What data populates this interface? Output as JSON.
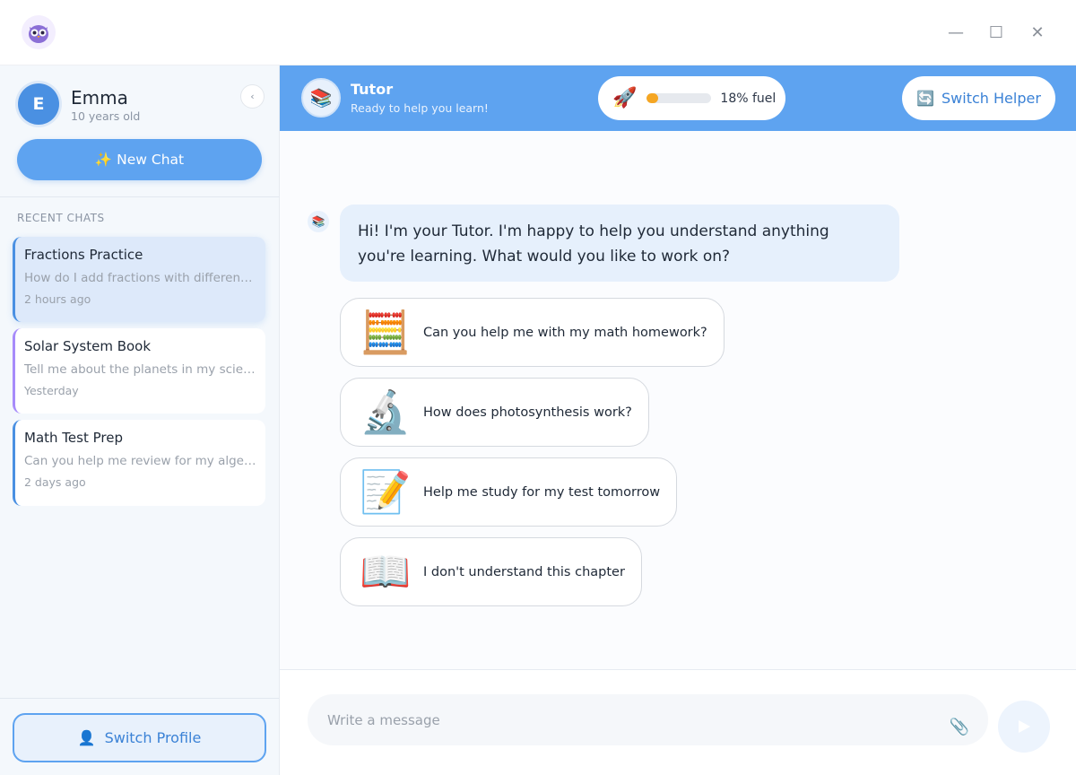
{
  "window": {
    "minimize_icon": "minimize-icon",
    "maximize_icon": "maximize-icon",
    "close_icon": "close-icon",
    "logo_icon": "owl-logo-icon",
    "minimize_glyph": "—",
    "maximize_glyph": "☐",
    "close_glyph": "✕"
  },
  "sidebar": {
    "user": {
      "initial": "E",
      "name": "Emma",
      "age": "10 years old"
    },
    "collapse_glyph": "‹",
    "new_chat_label": "✨ New Chat",
    "recent_title": "RECENT CHATS",
    "chats": [
      {
        "title": "Fractions Practice",
        "preview": "How do I add fractions with different denominators?",
        "time": "2 hours ago",
        "active": true,
        "accent": "#4a90e2"
      },
      {
        "title": "Solar System Book",
        "preview": "Tell me about the planets in my science book",
        "time": "Yesterday",
        "active": false,
        "accent": "#a78bfa"
      },
      {
        "title": "Math Test Prep",
        "preview": "Can you help me review for my algebra test?",
        "time": "2 days ago",
        "active": false,
        "accent": "#4a90e2"
      }
    ],
    "switch_profile_label": "Switch Profile",
    "switch_profile_glyph": "👤"
  },
  "header": {
    "tutor_glyph": "📚",
    "tutor_name": "Tutor",
    "tutor_status": "Ready to help you learn!",
    "fuel_glyph": "🚀",
    "fuel_percent": 18,
    "fuel_text": "18% fuel",
    "switch_helper_glyph": "🔄",
    "switch_helper_label": "Switch Helper"
  },
  "messages": {
    "bot_glyph": "📚",
    "greeting": "Hi! I'm your Tutor. I'm happy to help you understand anything you're learning. What would you like to work on?",
    "suggestions": [
      {
        "icon": "abacus-icon",
        "glyph": "🧮",
        "text": "Can you help me with my math homework?"
      },
      {
        "icon": "microscope-icon",
        "glyph": "🔬",
        "text": "How does photosynthesis work?"
      },
      {
        "icon": "memo-icon",
        "glyph": "📝",
        "text": "Help me study for my test tomorrow"
      },
      {
        "icon": "open-book-icon",
        "glyph": "📖",
        "text": "I don't understand this chapter"
      }
    ]
  },
  "composer": {
    "placeholder": "Write a message",
    "attach_glyph": "📎"
  },
  "colors": {
    "brand": "#5ea3f0",
    "accent_dark": "#3b82d6",
    "fuel": "#f5a623"
  }
}
